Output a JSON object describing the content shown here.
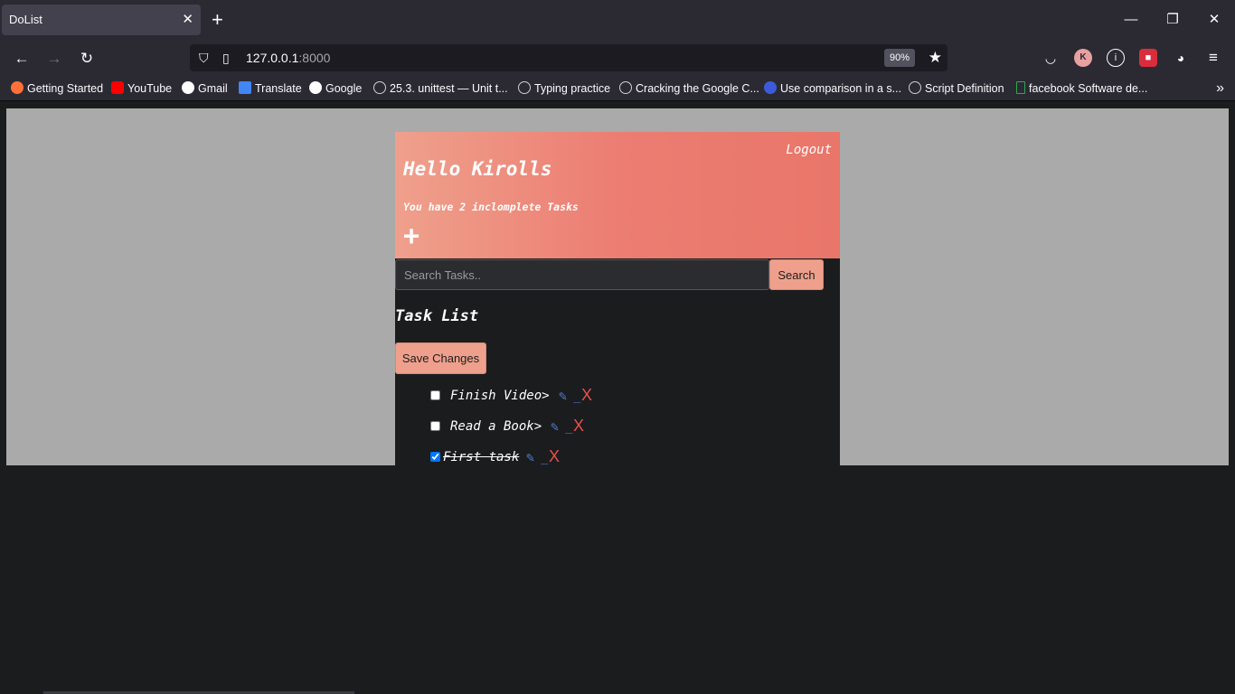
{
  "browser": {
    "tab_title": "DoList",
    "tab_close": "✕",
    "new_tab": "+",
    "url_host": "127.0.0.1",
    "url_port": ":8000",
    "zoom": "90%",
    "bookmarks": [
      {
        "label": "Getting Started",
        "color": "#ff7139"
      },
      {
        "label": "YouTube",
        "color": "#ff0000"
      },
      {
        "label": "Gmail",
        "color": "#ffffff"
      },
      {
        "label": "Translate",
        "color": "#4285f4"
      },
      {
        "label": "Google",
        "color": "#ffffff"
      },
      {
        "label": "25.3. unittest — Unit t...",
        "color": "#cfcfd8"
      },
      {
        "label": "Typing practice",
        "color": "#cfcfd8"
      },
      {
        "label": "Cracking the Google C...",
        "color": "#cfcfd8"
      },
      {
        "label": "Use comparison in a s...",
        "color": "#3b5bdb"
      },
      {
        "label": "Script Definition",
        "color": "#cfcfd8"
      },
      {
        "label": "facebook Software de...",
        "color": "#2fa84f"
      }
    ]
  },
  "app": {
    "logout": "Logout",
    "greeting": "Hello Kirolls",
    "incomplete_text": "You have 2 inclomplete Tasks",
    "add_symbol": "+",
    "search_placeholder": "Search Tasks..",
    "search_button": "Search",
    "list_title": "Task List",
    "save_button": "Save Changes",
    "tasks": [
      {
        "name": "Finish Video>",
        "checked": false,
        "done": false
      },
      {
        "name": "Read a Book>",
        "checked": false,
        "done": false
      },
      {
        "name": "First task",
        "checked": true,
        "done": true
      }
    ],
    "edit_symbol": "✎",
    "separator": "_",
    "delete_symbol": "X"
  },
  "colors": {
    "accent": "#efa08c",
    "header_gradient_end": "#e97669",
    "edit": "#4f7fd3",
    "delete": "#e8504d",
    "app_bg": "#1b1c1e",
    "page_bg": "#aaaaaa"
  }
}
